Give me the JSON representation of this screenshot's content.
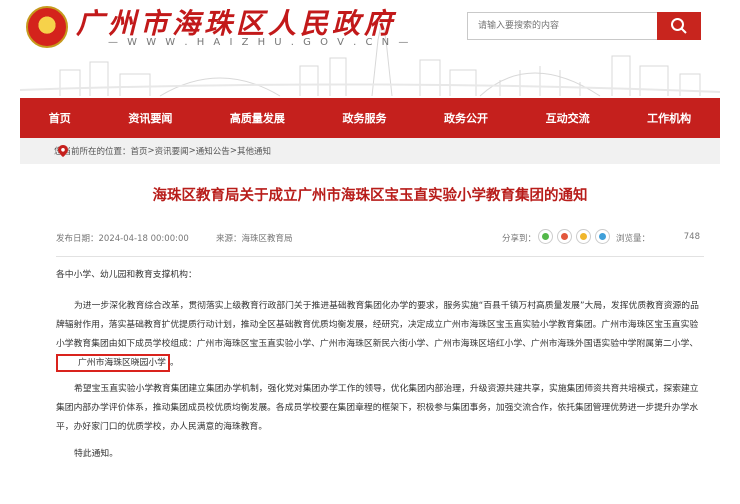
{
  "header": {
    "site_title": "广州市海珠区人民政府",
    "site_url": "— W W W . H A I Z H U . G O V . C N —",
    "search_placeholder": "请输入要搜索的内容"
  },
  "nav": {
    "items": [
      "首页",
      "资讯要闻",
      "高质量发展",
      "政务服务",
      "政务公开",
      "互动交流",
      "工作机构"
    ]
  },
  "breadcrumb": {
    "prefix": "您当前所在的位置：",
    "items": [
      "首页",
      "资讯要闻",
      "通知公告",
      "其他通知"
    ],
    "separator": " > "
  },
  "article": {
    "title": "海珠区教育局关于成立广州市海珠区宝玉直实验小学教育集团的通知",
    "publish_date": "发布日期：2024-04-18 00:00:00",
    "source": "来源：海珠区教育局",
    "share_label": "分享到：",
    "views_label": "浏览量：",
    "views_count": "748",
    "greeting": "各中小学、幼儿园和教育支撑机构：",
    "para1_main": "为进一步深化教育综合改革，贯彻落实上级教育行政部门关于推进基础教育集团化办学的要求，服务实施“百县千镇万村高质量发展”大局，发挥优质教育资源的品牌辐射作用，落实基础教育扩优提质行动计划，推动全区基础教育优质均衡发展，经研究，决定成立广州市海珠区宝玉直实验小学教育集团。广州市海珠区宝玉直实验小学教育集团由如下成员学校组成：广州市海珠区宝玉直实验小学、广州市海珠区新民六街小学、广州市海珠区培红小学、广州市海珠外国语实验中学附属第二小学、",
    "para1_highlight": "广州市海珠区晓园小学",
    "para1_end": "。",
    "para2": "希望宝玉直实验小学教育集团建立集团办学机制，强化党对集团办学工作的领导，优化集团内部治理，升级资源共建共享，实施集团师资共育共培模式，探索建立集团内部办学评价体系，推动集团成员校优质均衡发展。各成员学校要在集团章程的框架下，积极参与集团事务，加强交流合作，依托集团管理优势进一步提升办学水平，办好家门口的优质学校，办人民满意的海珠教育。",
    "closing": "特此通知。"
  },
  "colors": {
    "brand_red": "#c5201d",
    "title_red": "#b81d1a",
    "highlight_border": "#d9231d"
  },
  "icons": {
    "search": "search-icon",
    "location": "location-pin-icon",
    "share": [
      "wechat-icon",
      "weibo-icon",
      "qq-icon",
      "qzone-icon"
    ]
  }
}
